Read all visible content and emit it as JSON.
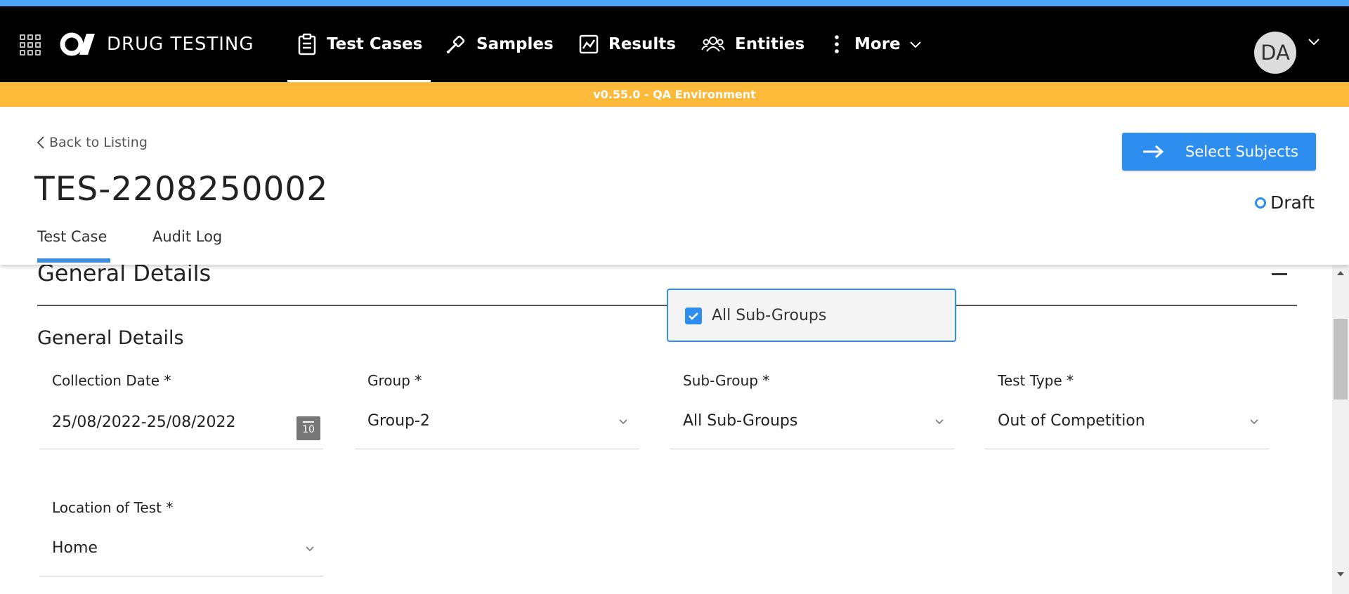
{
  "nav": {
    "app_title": "DRUG TESTING",
    "items": [
      {
        "label": "Test Cases",
        "icon": "clipboard-icon"
      },
      {
        "label": "Samples",
        "icon": "dropper-icon"
      },
      {
        "label": "Results",
        "icon": "chart-icon"
      },
      {
        "label": "Entities",
        "icon": "people-icon"
      },
      {
        "label": "More",
        "icon": "kebab-icon"
      }
    ],
    "active_item": "Test Cases",
    "user_initials": "DA"
  },
  "env_banner": "v0.55.0 - QA Environment",
  "header": {
    "back_label": "Back to Listing",
    "case_id": "TES-2208250002",
    "tabs": [
      {
        "label": "Test Case"
      },
      {
        "label": "Audit Log"
      }
    ],
    "active_tab": "Test Case",
    "primary_button": "Select Subjects",
    "status": "Draft"
  },
  "section": {
    "title": "General Details",
    "subtitle": "General Details"
  },
  "fields": {
    "collection_date": {
      "label": "Collection Date *",
      "value": "25/08/2022-25/08/2022",
      "calendar_day": "10"
    },
    "group": {
      "label": "Group *",
      "value": "Group-2"
    },
    "sub_group": {
      "label": "Sub-Group *",
      "value": "All Sub-Groups"
    },
    "test_type": {
      "label": "Test Type *",
      "value": "Out of Competition"
    },
    "location": {
      "label": "Location of Test *",
      "value": "Home"
    }
  },
  "dropdown": {
    "options": [
      {
        "label": "All Sub-Groups",
        "checked": true
      }
    ]
  },
  "colors": {
    "accent": "#2e8ef0",
    "env_banner": "#fdb93a",
    "navbar": "#000000"
  }
}
